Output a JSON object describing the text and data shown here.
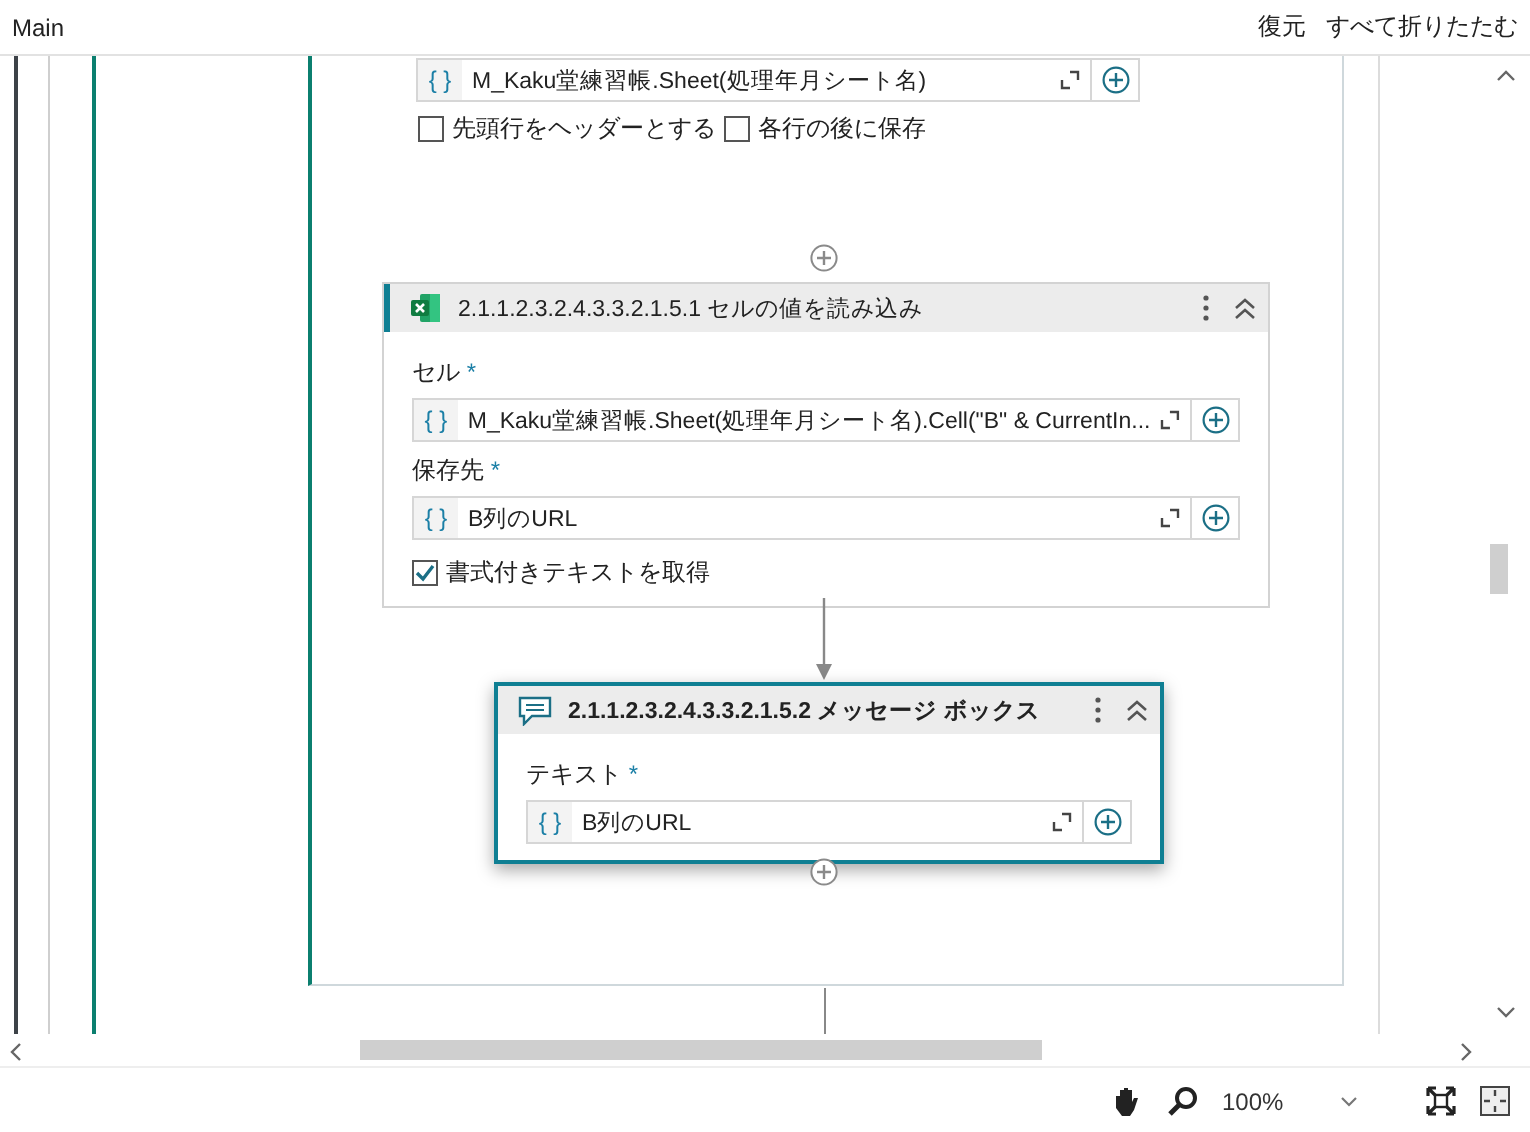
{
  "header": {
    "title": "Main",
    "actions": [
      "復元",
      "すべて折りたたむ"
    ]
  },
  "partial_activity": {
    "field": {
      "prefix": "{ }",
      "value": "M_Kaku堂練習帳.Sheet(処理年月シート名)"
    },
    "checkboxes": [
      {
        "label": "先頭行をヘッダーとする",
        "checked": false
      },
      {
        "label": "各行の後に保存",
        "checked": false
      }
    ]
  },
  "activities": [
    {
      "kind": "excel",
      "title": "2.1.1.2.3.2.4.3.3.2.1.5.1 セルの値を読み込み",
      "selected": false,
      "fields": [
        {
          "label": "セル",
          "marker": "*",
          "prefix": "{ }",
          "value": "M_Kaku堂練習帳.Sheet(処理年月シート名).Cell(\"B\" & CurrentIn..."
        },
        {
          "label": "保存先",
          "marker": "*",
          "prefix": "{ }",
          "value": "B列のURL"
        }
      ],
      "checkboxes": [
        {
          "label": "書式付きテキストを取得",
          "checked": true
        }
      ]
    },
    {
      "kind": "message",
      "title": "2.1.1.2.3.2.4.3.3.2.1.5.2 メッセージ ボックス",
      "selected": true,
      "fields": [
        {
          "label": "テキスト",
          "marker": "*",
          "prefix": "{ }",
          "value": "B列のURL"
        }
      ]
    }
  ],
  "zoom": {
    "value": "100%"
  }
}
